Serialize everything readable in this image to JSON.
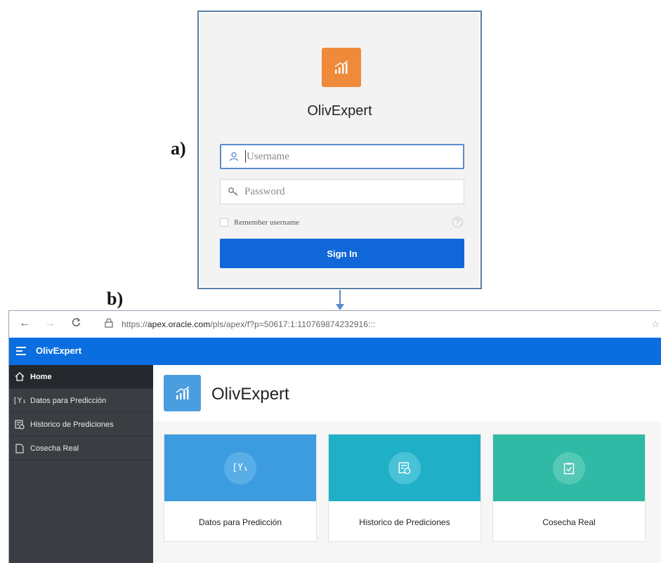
{
  "labels": {
    "a": "a)",
    "b": "b)"
  },
  "login": {
    "app_title": "OlivExpert",
    "username_placeholder": "Username",
    "password_placeholder": "Password",
    "remember_label": "Remember username",
    "help_symbol": "?",
    "signin_label": "Sign In",
    "logo_icon": "chart-bars-icon",
    "logo_color": "#ef8a3a"
  },
  "browser": {
    "url_prefix": "https://",
    "url_domain": "apex.oracle.com",
    "url_path": "/pls/apex/f?p=50617:1:110769874232916:::"
  },
  "app": {
    "name": "OlivExpert",
    "header_color": "#0a6ee0",
    "sidebar": {
      "items": [
        {
          "label": "Home",
          "icon": "home-icon"
        },
        {
          "label": "Datos para Predicción",
          "icon": "formula-icon"
        },
        {
          "label": "Historico de Prediciones",
          "icon": "calendar-clock-icon"
        },
        {
          "label": "Cosecha Real",
          "icon": "document-icon"
        }
      ]
    },
    "page_title": "OlivExpert",
    "cards": [
      {
        "label": "Datos para Predicción",
        "color": "#3d9be0",
        "icon": "formula-icon"
      },
      {
        "label": "Historico de Prediciones",
        "color": "#1fb0c8",
        "icon": "calendar-clock-icon"
      },
      {
        "label": "Cosecha Real",
        "color": "#2ebaa5",
        "icon": "clipboard-check-icon"
      }
    ]
  }
}
